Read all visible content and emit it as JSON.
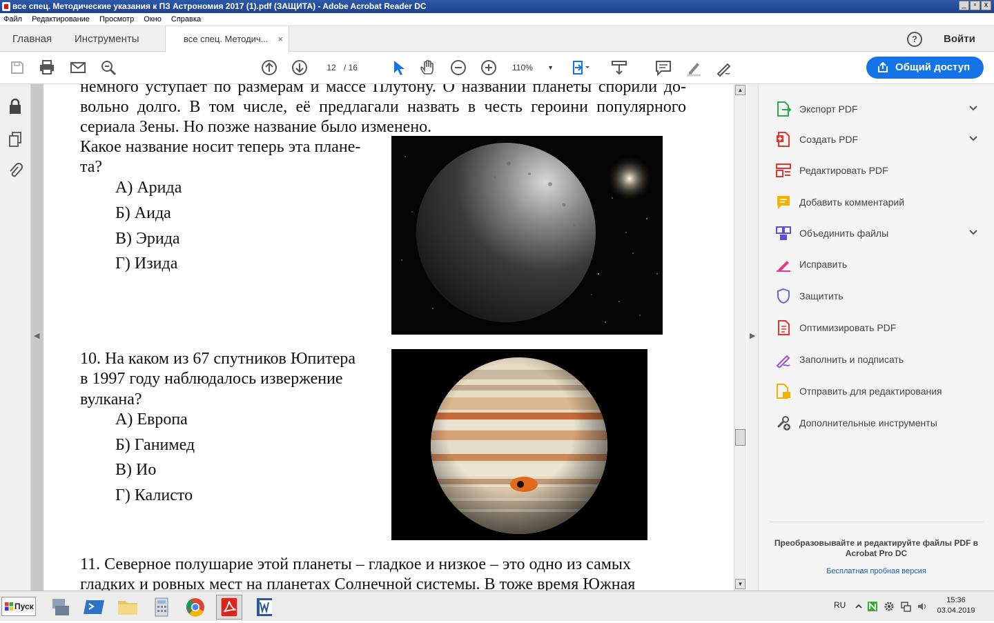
{
  "window": {
    "title": "все спец. Методические указания к ПЗ Астрономия 2017 (1).pdf (ЗАЩИТА) - Adobe Acrobat Reader DC"
  },
  "menu": [
    "Файл",
    "Редактирование",
    "Просмотр",
    "Окно",
    "Справка"
  ],
  "nav_tabs": {
    "home": "Главная",
    "tools": "Инструменты"
  },
  "doc_tab": {
    "label": "все спец. Методич...",
    "close": "×"
  },
  "header_right": {
    "login": "Войти",
    "help": "?"
  },
  "toolbar": {
    "page_current": "12",
    "page_total": "/ 16",
    "zoom": "110%",
    "share_label": "Общий доступ",
    "icons": [
      "save-icon",
      "print-icon",
      "mail-icon",
      "search-icon",
      "page-up-icon",
      "page-down-icon",
      "select-icon",
      "hand-icon",
      "zoom-out-icon",
      "zoom-in-icon",
      "fit-page-icon",
      "scroll-mode-icon",
      "comment-icon",
      "highlight-icon",
      "sign-icon"
    ]
  },
  "document": {
    "intro_lines": [
      "немного уступает по размерам и массе Плутону. О названии планеты спорили до-",
      "вольно долго. В том числе, её предлагали назвать в честь героини популярного",
      "сериала Зены. Но позже название было изменено."
    ],
    "q9": {
      "question_lines": [
        "Какое название носит теперь эта плане-",
        "та?"
      ],
      "options": [
        "А) Арида",
        "Б) Аида",
        "В) Эрида",
        "Г) Изида"
      ]
    },
    "q10": {
      "question_lines": [
        "10. На каком из 67 спутников Юпитера",
        "в 1997 году наблюдалось извержение",
        "вулкана?"
      ],
      "options": [
        "А) Европа",
        "Б) Ганимед",
        "В) Ио",
        "Г) Калисто"
      ]
    },
    "q11": {
      "lines": [
        "11. Северное полушарие этой планеты – гладкое и низкое – это одно из самых",
        "гладких и ровных мест на планетах Солнечной системы. В тоже время Южная"
      ]
    }
  },
  "tools_panel": {
    "items": [
      {
        "label": "Экспорт PDF",
        "icon": "export-pdf-icon",
        "color": "#2aa845",
        "chevron": true
      },
      {
        "label": "Создать PDF",
        "icon": "create-pdf-icon",
        "color": "#e3342f",
        "chevron": true
      },
      {
        "label": "Редактировать PDF",
        "icon": "edit-pdf-icon",
        "color": "#e3342f",
        "chevron": false
      },
      {
        "label": "Добавить комментарий",
        "icon": "comment-icon",
        "color": "#f0b400",
        "chevron": false
      },
      {
        "label": "Объединить файлы",
        "icon": "combine-files-icon",
        "color": "#5b4fd6",
        "chevron": true
      },
      {
        "label": "Исправить",
        "icon": "fill-edit-icon",
        "color": "#e6398c",
        "chevron": false
      },
      {
        "label": "Защитить",
        "icon": "shield-icon",
        "color": "#5b6fd6",
        "chevron": false
      },
      {
        "label": "Оптимизировать PDF",
        "icon": "optimize-pdf-icon",
        "color": "#e3342f",
        "chevron": false
      },
      {
        "label": "Заполнить и подписать",
        "icon": "fill-sign-icon",
        "color": "#9c4fd6",
        "chevron": false
      },
      {
        "label": "Отправить для редактирования",
        "icon": "send-review-icon",
        "color": "#f0b400",
        "chevron": false
      },
      {
        "label": "Дополнительные инструменты",
        "icon": "more-tools-icon",
        "color": "#555555",
        "chevron": false
      }
    ],
    "promo": "Преобразовывайте и редактируйте файлы PDF в Acrobat Pro DC",
    "trial_link": "Бесплатная пробная версия"
  },
  "taskbar": {
    "start_label": "Пуск",
    "apps": [
      "network-app-icon",
      "powershell-icon",
      "folder-icon",
      "calculator-icon",
      "chrome-icon",
      "acrobat-icon",
      "word-icon"
    ],
    "lang": "RU",
    "time": "15:36",
    "date": "03.04.2019"
  },
  "colors": {
    "accent": "#1473e6",
    "titlebar": "#1d4190"
  }
}
